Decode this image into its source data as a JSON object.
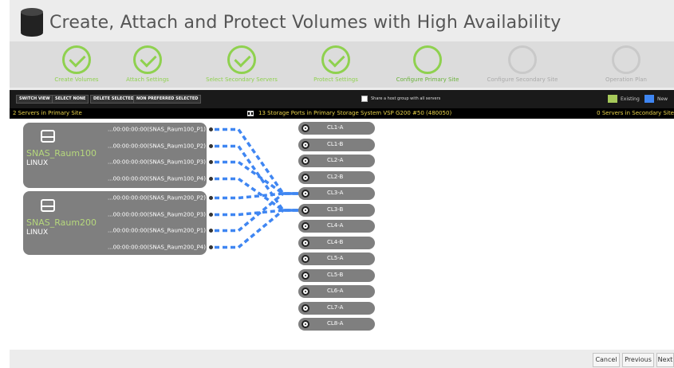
{
  "header": {
    "title": "Create, Attach and Protect Volumes with High Availability"
  },
  "steps": [
    {
      "label": "Create Volumes",
      "state": "done"
    },
    {
      "label": "Attach Settings",
      "state": "done"
    },
    {
      "label": "Select Secondary Servers",
      "state": "done"
    },
    {
      "label": "Protect Settings",
      "state": "done"
    },
    {
      "label": "Configure Primary Site",
      "state": "current"
    },
    {
      "label": "Configure Secondary Site",
      "state": "pending"
    },
    {
      "label": "Operation Plan",
      "state": "pending"
    }
  ],
  "toolbar": {
    "switch_view": "SWITCH VIEW",
    "select_none": "SELECT NONE",
    "delete_selected": "DELETE SELECTED",
    "non_preferred": "NON PREFERRED SELECTED",
    "share_label": "Share a host group with all servers",
    "legend_existing": "Existing",
    "legend_new": "New"
  },
  "colors": {
    "existing": "#a6c95a",
    "new": "#3f86f2",
    "accent": "#8fd14f",
    "info_text": "#e8d24a"
  },
  "infobar": {
    "left": "2 Servers in Primary Site",
    "center": "13 Storage Ports in Primary Storage System VSP G200 #50 (480050)",
    "right": "0 Servers in Secondary Site"
  },
  "servers": [
    {
      "name": "SNAS_Raum100",
      "os": "LINUX",
      "ports": [
        "...00:00:00:00(SNAS_Raum100_P1)",
        "...00:00:00:00(SNAS_Raum100_P2)",
        "...00:00:00:00(SNAS_Raum100_P3)",
        "...00:00:00:00(SNAS_Raum100_P4)"
      ]
    },
    {
      "name": "SNAS_Raum200",
      "os": "LINUX",
      "ports": [
        "...00:00:00:00(SNAS_Raum200_P2)",
        "...00:00:00:00(SNAS_Raum200_P3)",
        "...00:00:00:00(SNAS_Raum200_P1)",
        "...00:00:00:00(SNAS_Raum200_P4)"
      ]
    }
  ],
  "storage_ports": [
    "CL1-A",
    "CL1-B",
    "CL2-A",
    "CL2-B",
    "CL3-A",
    "CL3-B",
    "CL4-A",
    "CL4-B",
    "CL5-A",
    "CL5-B",
    "CL6-A",
    "CL7-A",
    "CL8-A"
  ],
  "connections": [
    {
      "from": "SNAS_Raum100_P1",
      "to": "CL3-A"
    },
    {
      "from": "SNAS_Raum100_P2",
      "to": "CL3-B"
    },
    {
      "from": "SNAS_Raum100_P3",
      "to": "CL3-A"
    },
    {
      "from": "SNAS_Raum100_P4",
      "to": "CL3-B"
    },
    {
      "from": "SNAS_Raum200_P2",
      "to": "CL3-A"
    },
    {
      "from": "SNAS_Raum200_P3",
      "to": "CL3-B"
    },
    {
      "from": "SNAS_Raum200_P1",
      "to": "CL3-A"
    },
    {
      "from": "SNAS_Raum200_P4",
      "to": "CL3-B"
    }
  ],
  "footer": {
    "cancel": "Cancel",
    "previous": "Previous",
    "next": "Next"
  }
}
